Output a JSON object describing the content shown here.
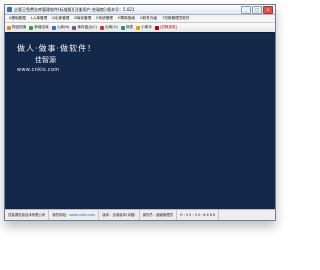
{
  "window": {
    "title": "企管王免费仓库管理软件(标准版)[注册用户:合瑞商]-版本号：5.021",
    "buttons": {
      "minimize": "_",
      "maximize": "□",
      "close": "×"
    }
  },
  "menu": {
    "items": [
      "A基础数据",
      "L入库管理",
      "D出库管理",
      "B库存管理",
      "E系统管理",
      "H帮助指南",
      "G软件升级",
      "T切换管理员软件"
    ]
  },
  "toolbar": {
    "items": [
      {
        "label": "物品档案",
        "icon": "box-icon",
        "color": "#d08b2a"
      },
      {
        "label": "新增出库",
        "icon": "add-icon",
        "color": "#3a9a3a"
      },
      {
        "label": "入库(N)",
        "icon": "in-icon",
        "color": "#2f6fc4"
      },
      {
        "label": "库存盘点(C)",
        "icon": "check-icon",
        "color": "#7a4fb0"
      },
      {
        "label": "出库(O)",
        "icon": "out-icon",
        "color": "#c0392b"
      },
      {
        "label": "报表",
        "icon": "report-icon",
        "color": "#2a8a8a"
      },
      {
        "label": "小助手",
        "icon": "helper-icon",
        "color": "#e0a100"
      },
      {
        "label": "[切换皮肤]",
        "icon": "skin-icon",
        "color": "#c00000"
      }
    ]
  },
  "content": {
    "slogan": "做人·做事·做软件！",
    "author": "佳智源",
    "site": "www.cnkis.com"
  },
  "status": {
    "company": "佳智源信息技术有限公司",
    "site_label": "我的网站：",
    "site_url": "www.cnkis.com",
    "version_label": "版本：合用版本(详细)",
    "operator": "操作员：超级管理员",
    "time": "H : 0 0 : 0 0 : 6 6 8 8"
  }
}
